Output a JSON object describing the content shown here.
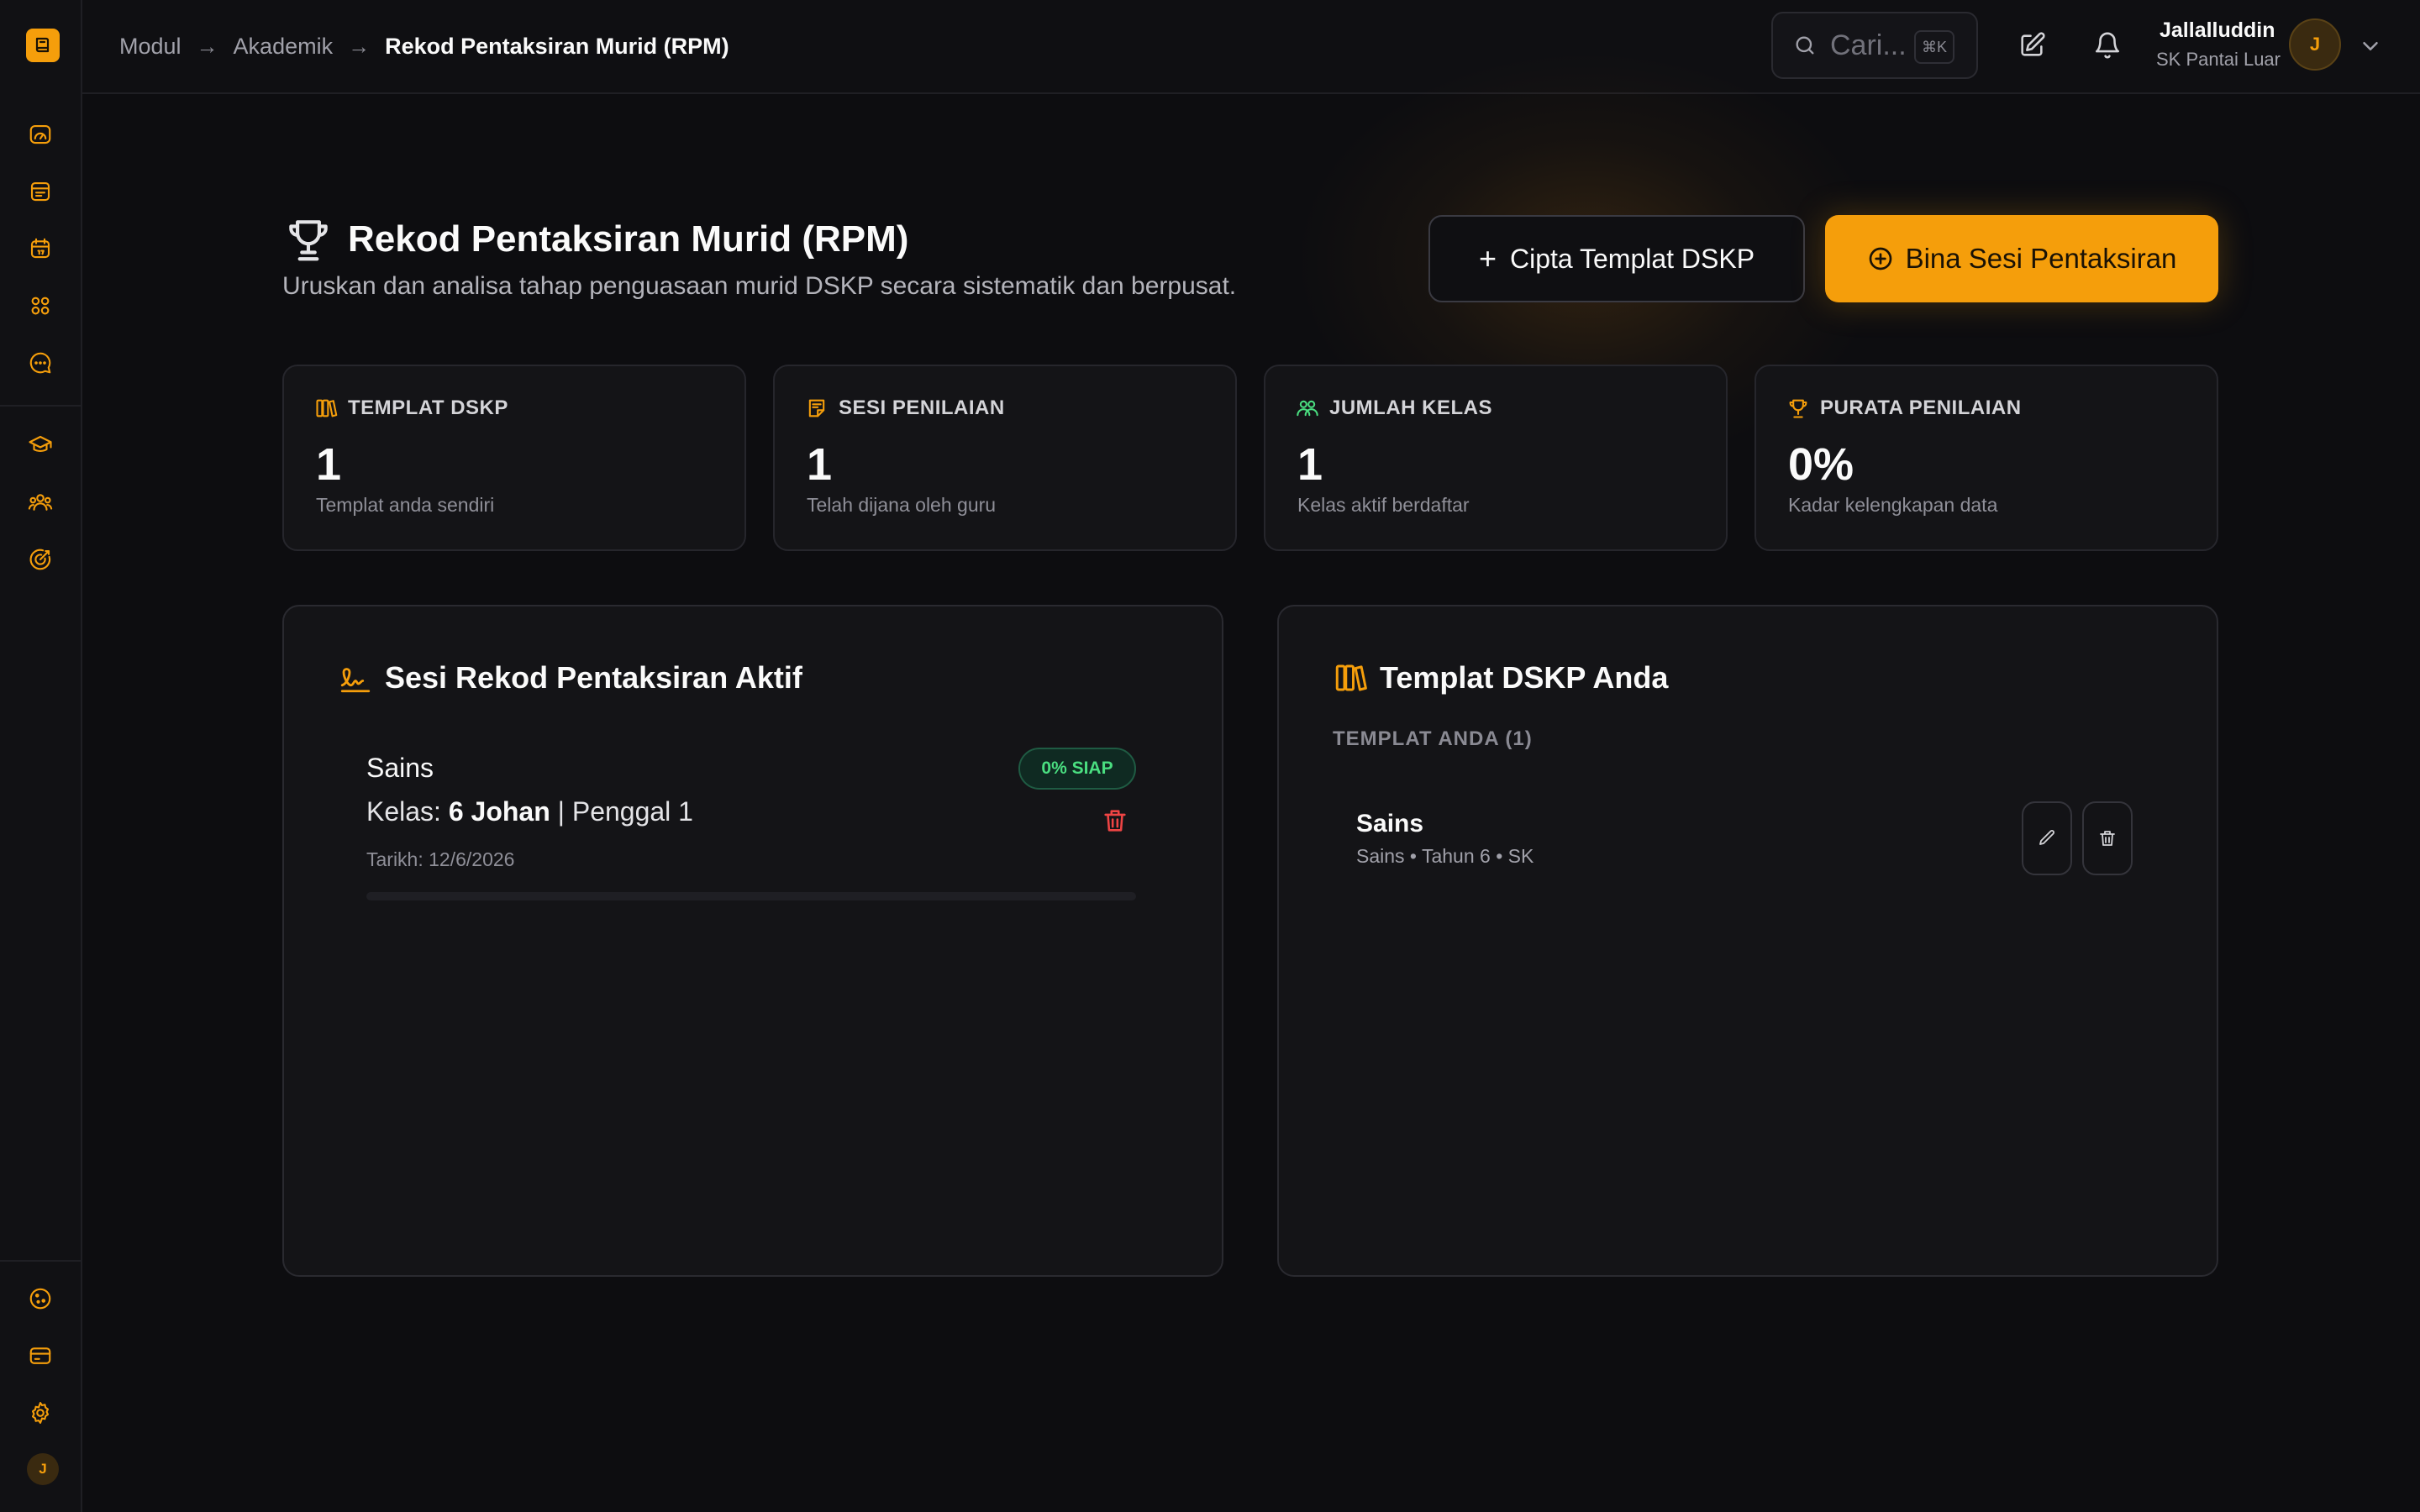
{
  "breadcrumb": {
    "items": [
      "Modul",
      "Akademik"
    ],
    "current": "Rekod Pentaksiran Murid (RPM)"
  },
  "search": {
    "placeholder": "Cari...",
    "shortcut": "⌘K"
  },
  "user": {
    "name": "Jallalluddin",
    "school": "SK Pantai Luar",
    "initial": "J"
  },
  "page": {
    "title": "Rekod Pentaksiran Murid (RPM)",
    "subtitle": "Uruskan dan analisa tahap penguasaan murid DSKP secara sistematik dan berpusat."
  },
  "actions": {
    "create_template": "Cipta Templat DSKP",
    "build_session": "Bina Sesi Pentaksiran"
  },
  "stats": [
    {
      "label": "TEMPLAT DSKP",
      "value": "1",
      "desc": "Templat anda sendiri",
      "icon": "book-icon",
      "color": "#f59e0b"
    },
    {
      "label": "SESI PENILAIAN",
      "value": "1",
      "desc": "Telah dijana oleh guru",
      "icon": "note-icon",
      "color": "#f59e0b"
    },
    {
      "label": "JUMLAH KELAS",
      "value": "1",
      "desc": "Kelas aktif berdaftar",
      "icon": "users-icon",
      "color": "#4ade80"
    },
    {
      "label": "PURATA PENILAIAN",
      "value": "0%",
      "desc": "Kadar kelengkapan data",
      "icon": "trophy-icon",
      "color": "#f59e0b"
    }
  ],
  "sessions_panel": {
    "title": "Sesi Rekod Pentaksiran Aktif",
    "session": {
      "subject": "Sains",
      "class_prefix": "Kelas: ",
      "class_name": "6 Johan",
      "class_suffix": " | Penggal 1",
      "date": "Tarikh: 12/6/2026",
      "badge": "0% SIAP",
      "progress": 0
    }
  },
  "templates_panel": {
    "title": "Templat DSKP Anda",
    "section_label": "TEMPLAT ANDA (1)",
    "template": {
      "name": "Sains",
      "meta": "Sains • Tahun 6 • SK"
    }
  },
  "colors": {
    "accent": "#f59e0b",
    "success": "#4ade80",
    "danger": "#ef4444"
  }
}
